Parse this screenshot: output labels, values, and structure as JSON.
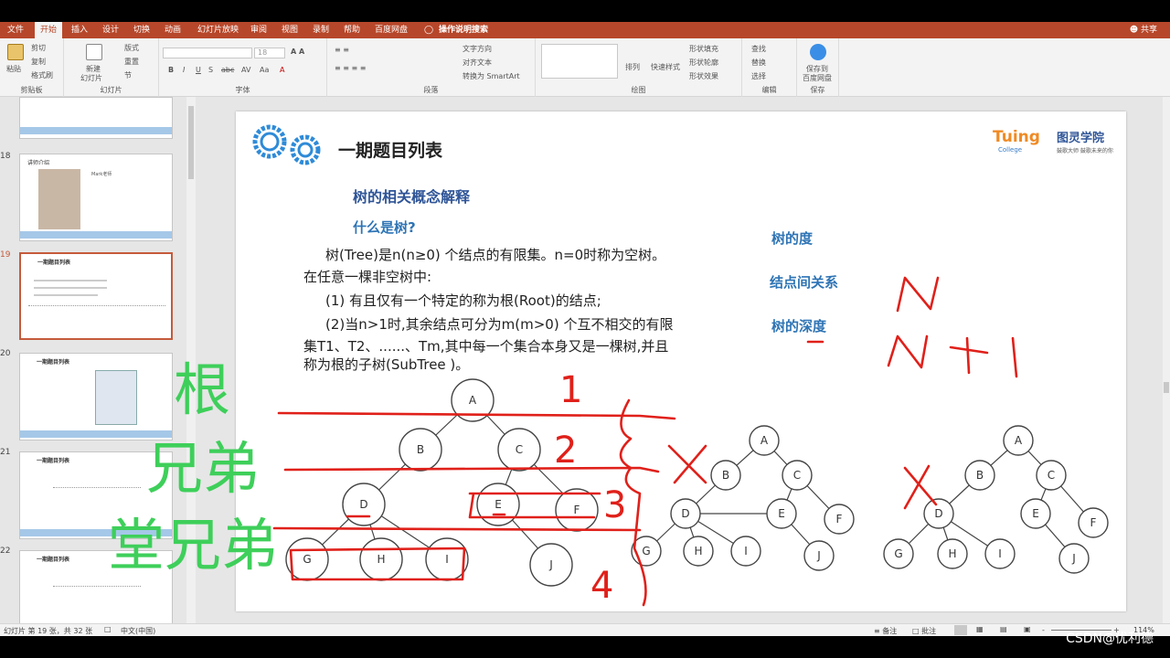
{
  "tabs": [
    "文件",
    "开始",
    "插入",
    "设计",
    "切换",
    "动画",
    "幻灯片放映",
    "审阅",
    "视图",
    "录制",
    "帮助",
    "百度网盘",
    "操作说明搜索"
  ],
  "share": "共享",
  "ribbon": {
    "clipboard": {
      "paste": "粘贴",
      "cut": "剪切",
      "copy": "复制",
      "format_painter": "格式刷",
      "label": "剪贴板"
    },
    "slides": {
      "new_slide_1": "新建",
      "new_slide_2": "幻灯片",
      "layout": "版式",
      "reset": "重置",
      "section": "节",
      "label": "幻灯片"
    },
    "font": {
      "size": "18",
      "label": "字体"
    },
    "paragraph": {
      "text_direction": "文字方向",
      "align_text": "对齐文本",
      "smartart": "转换为 SmartArt",
      "label": "段落"
    },
    "drawing": {
      "arrange": "排列",
      "quick_styles": "快速样式",
      "shape_fill": "形状填充",
      "shape_outline": "形状轮廓",
      "shape_effects": "形状效果",
      "label": "绘图"
    },
    "editing": {
      "find": "查找",
      "replace": "替换",
      "select": "选择",
      "label": "编辑"
    },
    "save": {
      "save_1": "保存到",
      "save_2": "百度网盘",
      "label": "保存"
    }
  },
  "thumbnails": [
    {
      "num": "18",
      "title": "讲师介绍",
      "name": "Mark老师"
    },
    {
      "num": "19",
      "title": "一期题目列表"
    },
    {
      "num": "20",
      "title": "一期题目列表"
    },
    {
      "num": "21",
      "title": "一期题目列表"
    },
    {
      "num": "22",
      "title": "一期题目列表"
    }
  ],
  "slide": {
    "title": "一期题目列表",
    "logo": "Tuing",
    "logo_sub": "College",
    "brand": "图灵学院",
    "brand_tagline": "鼓歌大师 鼓歌未来的你",
    "heading": "树的相关概念解释",
    "subheading": "什么是树?",
    "para1": "树(Tree)是n(n≥0) 个结点的有限集。n=0时称为空树。",
    "para2": "在任意一棵非空树中:",
    "para3": "(1)  有且仅有一个特定的称为根(Root)的结点;",
    "para4": "(2)当n>1时,其余结点可分为m(m>0) 个互不相交的有限",
    "para5": "集T1、T2、......、Tm,其中每一个集合本身又是一棵树,并且",
    "para6": "称为根的子树(SubTree )。",
    "side1": "树的度",
    "side2": "结点间关系",
    "side3": "树的深度",
    "ink_green": [
      "根",
      "兄弟",
      "堂兄弟"
    ],
    "ink_red_n": "N",
    "ink_red_n1": "N+1",
    "ink_levels": [
      "1",
      "2",
      "3",
      "4"
    ],
    "tree_nodes": [
      "A",
      "B",
      "C",
      "D",
      "E",
      "F",
      "G",
      "H",
      "I",
      "J"
    ]
  },
  "status": {
    "slide_info": "幻灯片 第 19 张，共 32 张",
    "language": "中文(中国)",
    "notes": "备注",
    "comments": "批注",
    "zoom": "114%"
  },
  "watermark": "CSDN@优利德",
  "colors": {
    "accent": "#b7472a",
    "ink_red": "#e0201a",
    "ink_green": "#3ecf5a",
    "title_blue": "#2f5597",
    "side_blue": "#2e74b5"
  }
}
